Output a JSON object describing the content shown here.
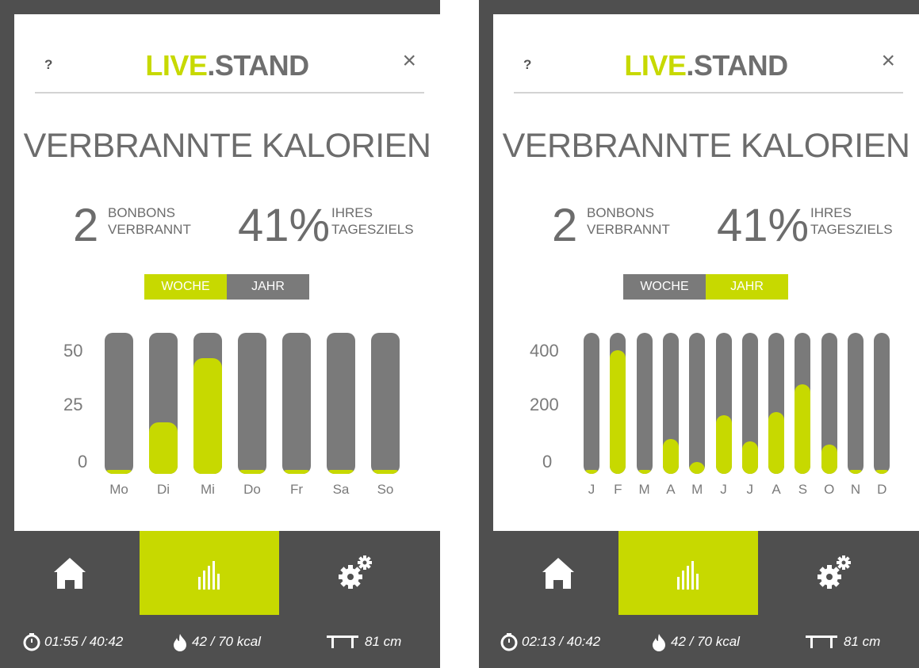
{
  "panels": [
    {
      "help": "?",
      "close": "×",
      "brand": {
        "part1": "LIVE",
        "part2": ".STAND"
      },
      "heading": "VERBRANNTE KALORIEN",
      "stat1": {
        "value": "2",
        "line1": "BONBONS",
        "line2": "VERBRANNT"
      },
      "stat2": {
        "value": "41%",
        "line1": "IHRES",
        "line2": "TAGESZIELS"
      },
      "toggle": {
        "week": "WOCHE",
        "year": "JAHR",
        "active": "week"
      },
      "y_ticks": [
        "50",
        "25",
        "0"
      ],
      "status": {
        "time": "01:55 / 40:42",
        "kcal": "42 / 70 kcal",
        "height": "81 cm"
      }
    },
    {
      "help": "?",
      "close": "×",
      "brand": {
        "part1": "LIVE",
        "part2": ".STAND"
      },
      "heading": "VERBRANNTE KALORIEN",
      "stat1": {
        "value": "2",
        "line1": "BONBONS",
        "line2": "VERBRANNT"
      },
      "stat2": {
        "value": "41%",
        "line1": "IHRES",
        "line2": "TAGESZIELS"
      },
      "toggle": {
        "week": "WOCHE",
        "year": "JAHR",
        "active": "year"
      },
      "y_ticks": [
        "400",
        "200",
        "0"
      ],
      "status": {
        "time": "02:13 / 40:42",
        "kcal": "42 / 70 kcal",
        "height": "81 cm"
      }
    }
  ],
  "nav": {
    "items": [
      "home-icon",
      "chart-icon",
      "settings-icon"
    ],
    "active": 1
  },
  "colors": {
    "accent": "#c7d900",
    "dark": "#4f4f4f",
    "bar": "#7a7a7a",
    "text": "#6c6c6c"
  },
  "chart_data": [
    {
      "type": "bar",
      "categories": [
        "Mo",
        "Di",
        "Mi",
        "Do",
        "Fr",
        "Sa",
        "So"
      ],
      "values": [
        0,
        20,
        45,
        0,
        0,
        0,
        0
      ],
      "ylim": [
        0,
        55
      ],
      "y_ticks": [
        0,
        25,
        50
      ]
    },
    {
      "type": "bar",
      "categories": [
        "J",
        "F",
        "M",
        "A",
        "M",
        "J",
        "J",
        "A",
        "S",
        "O",
        "N",
        "D"
      ],
      "values": [
        0,
        420,
        0,
        120,
        40,
        200,
        110,
        210,
        305,
        100,
        0,
        0
      ],
      "ylim": [
        0,
        480
      ],
      "y_ticks": [
        0,
        200,
        400
      ]
    }
  ]
}
